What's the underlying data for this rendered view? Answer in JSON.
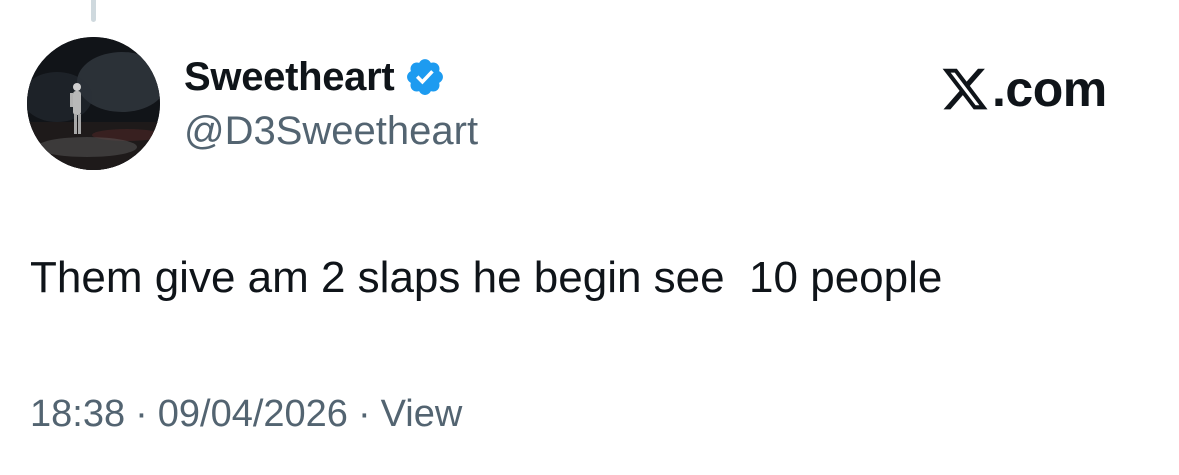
{
  "author": {
    "display_name": "Sweetheart",
    "handle": "@D3Sweetheart",
    "verified": true,
    "avatar_icon": "avatar-person-on-stage",
    "verified_icon": "verified-badge-icon"
  },
  "brand": {
    "logo_icon": "x-logo-icon",
    "suffix": ".com"
  },
  "tweet": {
    "text": "Them give am 2 slaps he begin see  10 people"
  },
  "meta": {
    "time": "18:38",
    "separator": "·",
    "date": "09/04/2026",
    "views_label": "View"
  },
  "colors": {
    "text_primary": "#0f1419",
    "text_secondary": "#536471",
    "verified_blue": "#1d9bf0",
    "thread_line": "#cfd9de"
  }
}
